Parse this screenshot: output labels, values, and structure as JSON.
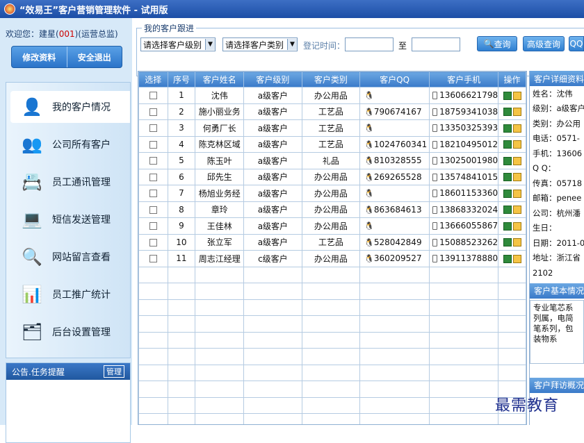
{
  "app": {
    "title": "“效易王”客户营销管理软件 - 试用版"
  },
  "sidebar": {
    "welcome_prefix": "欢迎您：建星(",
    "welcome_code": "001",
    "welcome_suffix": ")(运营总监)",
    "edit_label": "修改资料",
    "logout_label": "安全退出",
    "items": [
      {
        "label": "我的客户情况",
        "icon": "user-icon"
      },
      {
        "label": "公司所有客户",
        "icon": "group-icon"
      },
      {
        "label": "员工通讯管理",
        "icon": "contact-card-icon"
      },
      {
        "label": "短信发送管理",
        "icon": "laptop-icon"
      },
      {
        "label": "网站留言查看",
        "icon": "magnifier-icon"
      },
      {
        "label": "员工推广统计",
        "icon": "bar-chart-icon"
      },
      {
        "label": "后台设置管理",
        "icon": "settings-folder-icon"
      }
    ],
    "notice_title": "公告.任务提醒",
    "notice_manage": "管理"
  },
  "filter": {
    "legend": "我的客户跟进",
    "level_placeholder": "请选择客户级别",
    "type_placeholder": "请选择客户类别",
    "date_label": "登记时间：",
    "to_label": "至",
    "query_label": "查询",
    "advanced_label": "高级查询",
    "qq_label": "QQ"
  },
  "table": {
    "headers": [
      "选择",
      "序号",
      "客户姓名",
      "客户级别",
      "客户类别",
      "客户QQ",
      "客户手机",
      "操作"
    ],
    "rows": [
      {
        "no": "1",
        "name": "沈伟",
        "level": "a级客户",
        "type": "办公用品",
        "qq": "",
        "phone": "13606621798"
      },
      {
        "no": "2",
        "name": "施小丽业务",
        "level": "a级客户",
        "type": "工艺品",
        "qq": "790674167",
        "phone": "18759341038"
      },
      {
        "no": "3",
        "name": "何勇厂长",
        "level": "a级客户",
        "type": "工艺品",
        "qq": "",
        "phone": "13350325393"
      },
      {
        "no": "4",
        "name": "陈克林区域",
        "level": "a级客户",
        "type": "工艺品",
        "qq": "1024760341",
        "phone": "18210495012"
      },
      {
        "no": "5",
        "name": "陈玉叶",
        "level": "a级客户",
        "type": "礼品",
        "qq": "810328555",
        "phone": "13025001980"
      },
      {
        "no": "6",
        "name": "邱先生",
        "level": "a级客户",
        "type": "办公用品",
        "qq": "269265528",
        "phone": "13574841015"
      },
      {
        "no": "7",
        "name": "杨旭业务经",
        "level": "a级客户",
        "type": "办公用品",
        "qq": "",
        "phone": "18601153360"
      },
      {
        "no": "8",
        "name": "章玲",
        "level": "a级客户",
        "type": "办公用品",
        "qq": "863684613",
        "phone": "13868332024"
      },
      {
        "no": "9",
        "name": "王佳林",
        "level": "a级客户",
        "type": "办公用品",
        "qq": "",
        "phone": "13666055867"
      },
      {
        "no": "10",
        "name": "张立军",
        "level": "a级客户",
        "type": "工艺品",
        "qq": "528042849",
        "phone": "15088523262"
      },
      {
        "no": "11",
        "name": "周志江经理",
        "level": "c级客户",
        "type": "办公用品",
        "qq": "360209527",
        "phone": "13911378880"
      }
    ]
  },
  "detail": {
    "title": "客户详细资料",
    "fields": [
      "姓名：沈伟",
      "级别：a级客户",
      "类别：办公用",
      "电话：0571-",
      "手机：13606",
      "Q Q：",
      "传真：05718",
      "邮箱：penee",
      "公司：杭州潘",
      "生日：",
      "日期：2011-0",
      "地址：浙江省"
    ],
    "address_cont": "2102",
    "basic_title": "客户基本情况",
    "basic_text": "专业笔芯系列属，电简笔系列，包装物系",
    "visit_title": "客户拜访概况"
  },
  "watermark": "最需教育"
}
